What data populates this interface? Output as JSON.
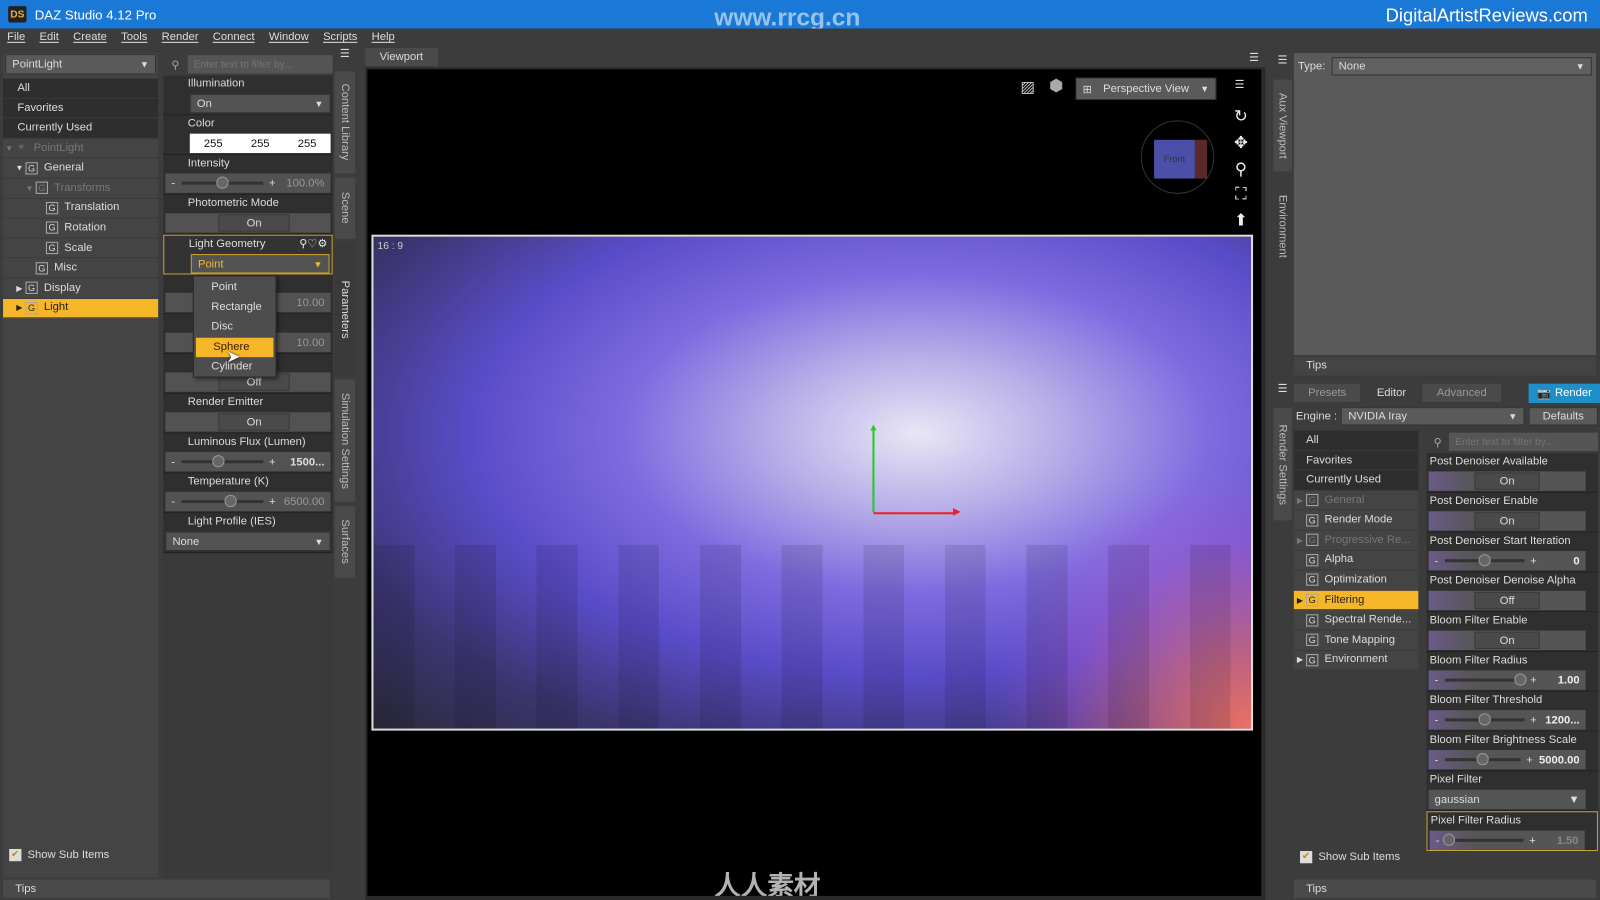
{
  "app": {
    "title": "DAZ Studio 4.12 Pro",
    "logo": "DS",
    "watermark_center": "www.rrcg.cn",
    "watermark_right": "DigitalArtistReviews.com",
    "watermark_bottom": "人人素材"
  },
  "menu": [
    "File",
    "Edit",
    "Create",
    "Tools",
    "Render",
    "Connect",
    "Window",
    "Scripts",
    "Help"
  ],
  "left": {
    "node_select": "PointLight",
    "filters": [
      "All",
      "Favorites",
      "Currently Used"
    ],
    "tree": [
      {
        "label": "PointLight",
        "depth": 0,
        "tri": "▼",
        "dim": true,
        "icon": "light"
      },
      {
        "label": "General",
        "depth": 1,
        "tri": "▼"
      },
      {
        "label": "Transforms",
        "depth": 2,
        "tri": "▼",
        "dim": true
      },
      {
        "label": "Translation",
        "depth": 3
      },
      {
        "label": "Rotation",
        "depth": 3
      },
      {
        "label": "Scale",
        "depth": 3
      },
      {
        "label": "Misc",
        "depth": 2
      },
      {
        "label": "Display",
        "depth": 1,
        "tri": "▶"
      },
      {
        "label": "Light",
        "depth": 1,
        "tri": "▶",
        "selected": true
      }
    ],
    "show_sub_items": "Show Sub Items",
    "tips": "Tips"
  },
  "params": {
    "filter_placeholder": "Enter text to filter by...",
    "illumination": {
      "label": "Illumination",
      "value": "On"
    },
    "color": {
      "label": "Color",
      "r": "255",
      "g": "255",
      "b": "255"
    },
    "intensity": {
      "label": "Intensity",
      "value": "100.0%",
      "fraction": 0.5
    },
    "photometric": {
      "label": "Photometric Mode",
      "value": "On"
    },
    "geometry": {
      "label": "Light Geometry",
      "value": "Point",
      "options": [
        "Point",
        "Rectangle",
        "Disc",
        "Sphere",
        "Cylinder"
      ],
      "highlighted": "Sphere"
    },
    "hidden1_value": "10.00",
    "hidden2_value": "10.00",
    "hidden3_value": "Off",
    "render_emitter": {
      "label": "Render Emitter",
      "value": "On"
    },
    "flux": {
      "label": "Luminous Flux (Lumen)",
      "value": "1500...",
      "fraction": 0.45
    },
    "temperature": {
      "label": "Temperature (K)",
      "value": "6500.00",
      "fraction": 0.6
    },
    "profile": {
      "label": "Light Profile (IES)",
      "value": "None"
    }
  },
  "side_tabs_left": [
    "Content Library",
    "Scene",
    "Parameters",
    "Simulation Settings",
    "Surfaces"
  ],
  "viewport": {
    "tab": "Viewport",
    "view": "Perspective View",
    "aspect": "16 : 9",
    "cube_label": "Front"
  },
  "side_tabs_right": [
    "Aux Viewport",
    "Environment",
    "Render Settings"
  ],
  "aux": {
    "type_label": "Type:",
    "type_value": "None",
    "tips": "Tips"
  },
  "render": {
    "tabs": [
      "Presets",
      "Editor",
      "Advanced"
    ],
    "active_tab": "Editor",
    "render_button": "Render",
    "engine_label": "Engine :",
    "engine": "NVIDIA Iray",
    "defaults": "Defaults",
    "filter_placeholder": "Enter text to filter by...",
    "filters": [
      "All",
      "Favorites",
      "Currently Used"
    ],
    "groups": [
      {
        "label": "General",
        "tri": "▶",
        "dim": true
      },
      {
        "label": "Render Mode"
      },
      {
        "label": "Progressive Re...",
        "tri": "▶",
        "dim": true
      },
      {
        "label": "Alpha"
      },
      {
        "label": "Optimization"
      },
      {
        "label": "Filtering",
        "tri": "▶",
        "selected": true
      },
      {
        "label": "Spectral Rende..."
      },
      {
        "label": "Tone Mapping"
      },
      {
        "label": "Environment",
        "tri": "▶"
      }
    ],
    "props": [
      {
        "label": "Post Denoiser Available",
        "type": "switch",
        "value": "On"
      },
      {
        "label": "Post Denoiser Enable",
        "type": "switch",
        "value": "On"
      },
      {
        "label": "Post Denoiser Start Iteration",
        "type": "slider",
        "value": "0",
        "fraction": 0.5
      },
      {
        "label": "Post Denoiser Denoise Alpha",
        "type": "switch",
        "value": "Off"
      },
      {
        "label": "Bloom Filter Enable",
        "type": "switch",
        "value": "On"
      },
      {
        "label": "Bloom Filter Radius",
        "type": "slider",
        "value": "1.00",
        "fraction": 0.95
      },
      {
        "label": "Bloom Filter Threshold",
        "type": "slider",
        "value": "1200...",
        "fraction": 0.5
      },
      {
        "label": "Bloom Filter Brightness Scale",
        "type": "slider",
        "value": "5000.00",
        "fraction": 0.5
      },
      {
        "label": "Pixel Filter",
        "type": "dropdown",
        "value": "gaussian"
      },
      {
        "label": "Pixel Filter Radius",
        "type": "slider",
        "value": "1.50",
        "fraction": 0.05,
        "highlighted": true
      }
    ],
    "show_sub_items": "Show Sub Items",
    "tips": "Tips"
  },
  "colors": {
    "accent": "#f5b628",
    "titlebar": "#1a78d6",
    "render_button": "#1e8fc8"
  }
}
